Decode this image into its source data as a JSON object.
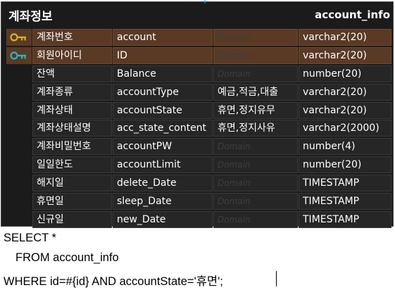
{
  "entity": {
    "logical_name": "계좌정보",
    "physical_name": "account_info",
    "domain_placeholder": "Domain",
    "colors": {
      "primary_key_row": "#5a3a25",
      "key_icon": "#d4b02a",
      "fk_key_icon": "#27b3c6",
      "background": "#1b1b1b"
    },
    "columns": [
      {
        "logical": "계좌번호",
        "physical": "account",
        "domain": "",
        "type": "varchar2(20)",
        "key": "pk"
      },
      {
        "logical": "회원아이디",
        "physical": "ID",
        "domain": "",
        "type": "varchar2(20)",
        "key": "pfk"
      },
      {
        "logical": "잔액",
        "physical": "Balance",
        "domain": "",
        "type": "number(20)",
        "key": ""
      },
      {
        "logical": "계좌종류",
        "physical": "accountType",
        "domain": "예금,적금,대출",
        "type": "varchar2(20)",
        "key": ""
      },
      {
        "logical": "계좌상태",
        "physical": "accountState",
        "domain": "휴면,정지유무",
        "type": "varchar2(20)",
        "key": ""
      },
      {
        "logical": "계좌상태설명",
        "physical": "acc_state_content",
        "domain": "휴면,정지사유",
        "type": "varchar2(2000)",
        "key": ""
      },
      {
        "logical": "계좌비밀번호",
        "physical": "accountPW",
        "domain": "",
        "type": "number(4)",
        "key": ""
      },
      {
        "logical": "일일한도",
        "physical": "accountLimit",
        "domain": "",
        "type": "number(20)",
        "key": ""
      },
      {
        "logical": "해지일",
        "physical": "delete_Date",
        "domain": "",
        "type": "TIMESTAMP",
        "key": ""
      },
      {
        "logical": "휴면일",
        "physical": "sleep_Date",
        "domain": "",
        "type": "TIMESTAMP",
        "key": ""
      },
      {
        "logical": "신규일",
        "physical": "new_Date",
        "domain": "",
        "type": "TIMESTAMP",
        "key": ""
      }
    ]
  },
  "sql": {
    "line1": "SELECT *",
    "line2": "FROM account_info",
    "line3": "WHERE id=#{id} AND accountState='휴면';"
  }
}
